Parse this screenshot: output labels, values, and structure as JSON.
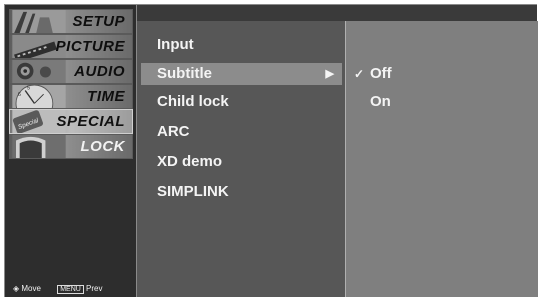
{
  "sidebar": {
    "tabs": [
      {
        "label": "SETUP",
        "icon": "setup-thumbnail-icon",
        "active": false
      },
      {
        "label": "PICTURE",
        "icon": "picture-thumbnail-icon",
        "active": false
      },
      {
        "label": "AUDIO",
        "icon": "audio-thumbnail-icon",
        "active": false
      },
      {
        "label": "TIME",
        "icon": "time-thumbnail-icon",
        "active": false
      },
      {
        "label": "SPECIAL",
        "icon": "special-thumbnail-icon",
        "active": true
      },
      {
        "label": "LOCK",
        "icon": "lock-thumbnail-icon",
        "active": false
      }
    ],
    "legend": {
      "move": "Move",
      "menu_key": "MENU",
      "prev": "Prev"
    }
  },
  "menu": {
    "items": [
      {
        "label": "Input"
      },
      {
        "label": "Subtitle",
        "selected": true
      },
      {
        "label": "Child lock"
      },
      {
        "label": "ARC"
      },
      {
        "label": "XD demo"
      },
      {
        "label": "SIMPLINK"
      }
    ],
    "arrow": "▶"
  },
  "submenu": {
    "items": [
      {
        "label": "Off",
        "checked": true,
        "check": "✓"
      },
      {
        "label": "On",
        "checked": false,
        "check": ""
      }
    ]
  },
  "colors": {
    "panel_dark": "#2d2d2d",
    "panel_mid": "#575757",
    "panel_light": "#7f7f7f",
    "highlight": "#8c8c8c",
    "text": "#f4f4f4"
  }
}
